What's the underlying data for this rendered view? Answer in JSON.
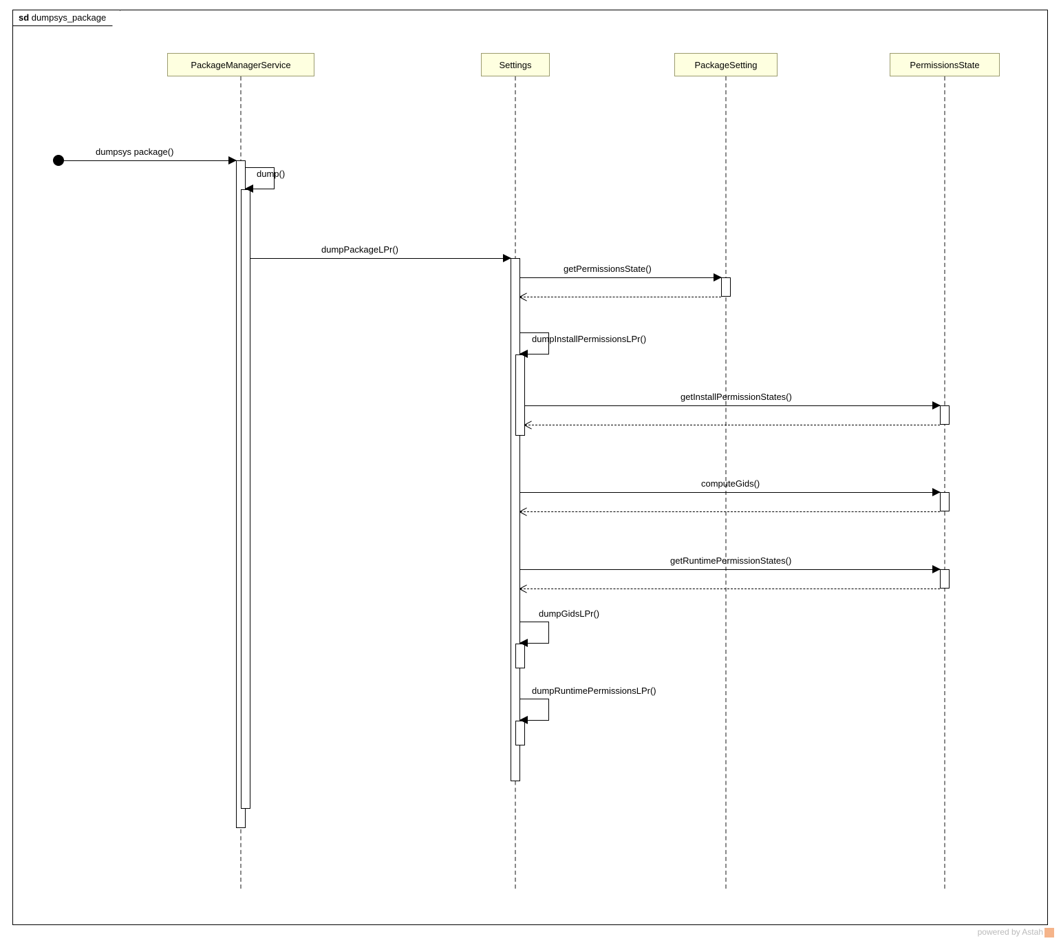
{
  "frame": {
    "prefix": "sd",
    "name": "dumpsys_package"
  },
  "lifelines": {
    "pms": "PackageManagerService",
    "settings": "Settings",
    "pkgSetting": "PackageSetting",
    "permState": "PermissionsState"
  },
  "messages": {
    "found": "dumpsys package()",
    "dump": "dump()",
    "dumpPackageLPr": "dumpPackageLPr()",
    "getPermissionsState": "getPermissionsState()",
    "dumpInstallPermissionsLPr": "dumpInstallPermissionsLPr()",
    "getInstallPermissionStates": "getInstallPermissionStates()",
    "computeGids": "computeGids()",
    "getRuntimePermissionStates": "getRuntimePermissionStates()",
    "dumpGidsLPr": "dumpGidsLPr()",
    "dumpRuntimePermissionsLPr": "dumpRuntimePermissionsLPr()"
  },
  "watermark": "powered by Astah"
}
